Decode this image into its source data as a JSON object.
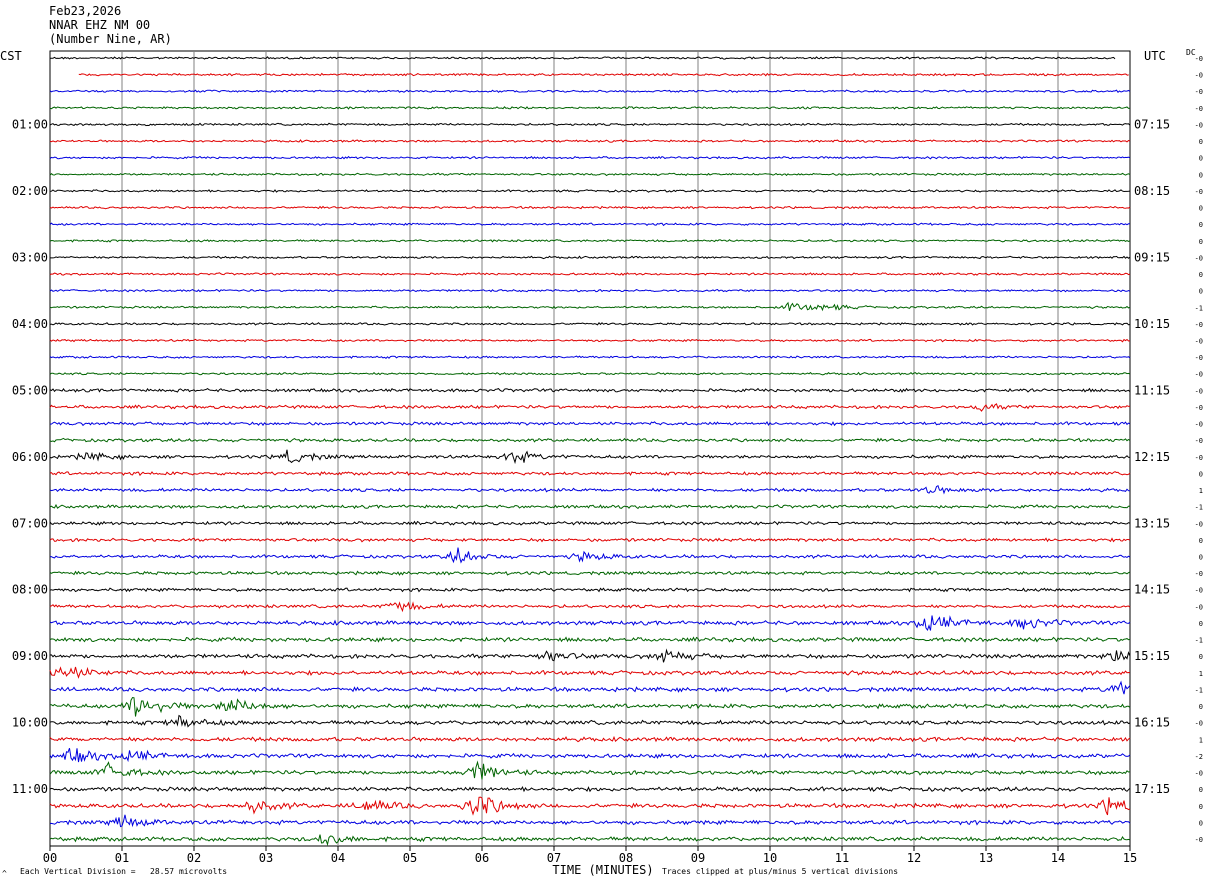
{
  "header": {
    "date": "Feb23,2026",
    "station": "NNAR EHZ NM 00",
    "location": "(Number Nine, AR)"
  },
  "left_tz": "CST",
  "right_tz": "UTC",
  "dc_label": "DC",
  "footer": {
    "scale_note": "Each Vertical Division =   28.57 microvolts",
    "clip_note": "Traces clipped at plus/minus 5 vertical divisions",
    "corner_mark": "^"
  },
  "chart_data": {
    "type": "line",
    "title": "",
    "xlabel": "TIME (MINUTES)",
    "ylabel": "",
    "xlim": [
      0,
      15
    ],
    "x_ticks": [
      "00",
      "01",
      "02",
      "03",
      "04",
      "05",
      "06",
      "07",
      "08",
      "09",
      "10",
      "11",
      "12",
      "13",
      "14",
      "15"
    ],
    "left_hour_labels": [
      "01:00",
      "02:00",
      "03:00",
      "04:00",
      "05:00",
      "06:00",
      "07:00",
      "08:00",
      "09:00",
      "10:00",
      "11:00"
    ],
    "right_hour_labels": [
      "07:15",
      "08:15",
      "09:15",
      "10:15",
      "11:15",
      "12:15",
      "13:15",
      "14:15",
      "15:15",
      "16:15",
      "17:15"
    ],
    "trace_colors": [
      "#000000",
      "#e00000",
      "#0000e0",
      "#006400"
    ],
    "trace_count": 48,
    "minutes_per_trace": 15,
    "dc_offsets": [
      "-0",
      "-0",
      "-0",
      "-0",
      "-0",
      "0",
      "0",
      "0",
      "-0",
      "0",
      "0",
      "0",
      "-0",
      "0",
      "0",
      "-1",
      "-0",
      "-0",
      "-0",
      "-0",
      "-0",
      "-0",
      "-0",
      "-0",
      "-0",
      "0",
      "1",
      "-1",
      "-0",
      "0",
      "0",
      "-0",
      "-0",
      "-0",
      "0",
      "-1",
      "0",
      "1",
      "-1",
      "0",
      "-0",
      "1",
      "-2",
      "-0",
      "0",
      "0",
      "0",
      "-0"
    ],
    "events": [
      {
        "trace": 15,
        "minute": 10.3,
        "amp": 6
      },
      {
        "trace": 15,
        "minute": 10.7,
        "amp": 5
      },
      {
        "trace": 21,
        "minute": 12.9,
        "amp": 4
      },
      {
        "trace": 24,
        "minute": 0.5,
        "amp": 5
      },
      {
        "trace": 24,
        "minute": 3.3,
        "amp": 8
      },
      {
        "trace": 24,
        "minute": 6.4,
        "amp": 9
      },
      {
        "trace": 26,
        "minute": 12.2,
        "amp": 5
      },
      {
        "trace": 30,
        "minute": 5.65,
        "amp": 10
      },
      {
        "trace": 30,
        "minute": 7.4,
        "amp": 6
      },
      {
        "trace": 33,
        "minute": 4.8,
        "amp": 7
      },
      {
        "trace": 34,
        "minute": 12.2,
        "amp": 14
      },
      {
        "trace": 34,
        "minute": 13.5,
        "amp": 8
      },
      {
        "trace": 36,
        "minute": 6.9,
        "amp": 7
      },
      {
        "trace": 36,
        "minute": 8.5,
        "amp": 8
      },
      {
        "trace": 36,
        "minute": 14.8,
        "amp": 8
      },
      {
        "trace": 37,
        "minute": 0.15,
        "amp": 12
      },
      {
        "trace": 38,
        "minute": 14.8,
        "amp": 9
      },
      {
        "trace": 39,
        "minute": 1.2,
        "amp": 18
      },
      {
        "trace": 39,
        "minute": 2.5,
        "amp": 12
      },
      {
        "trace": 40,
        "minute": 1.8,
        "amp": 9
      },
      {
        "trace": 42,
        "minute": 0.3,
        "amp": 10
      },
      {
        "trace": 42,
        "minute": 1.1,
        "amp": 8
      },
      {
        "trace": 43,
        "minute": 0.8,
        "amp": 10
      },
      {
        "trace": 43,
        "minute": 5.9,
        "amp": 14
      },
      {
        "trace": 45,
        "minute": 2.8,
        "amp": 9
      },
      {
        "trace": 45,
        "minute": 4.4,
        "amp": 9
      },
      {
        "trace": 45,
        "minute": 5.9,
        "amp": 18
      },
      {
        "trace": 45,
        "minute": 14.7,
        "amp": 10
      },
      {
        "trace": 46,
        "minute": 1.0,
        "amp": 8
      },
      {
        "trace": 47,
        "minute": 3.8,
        "amp": 8
      }
    ]
  }
}
